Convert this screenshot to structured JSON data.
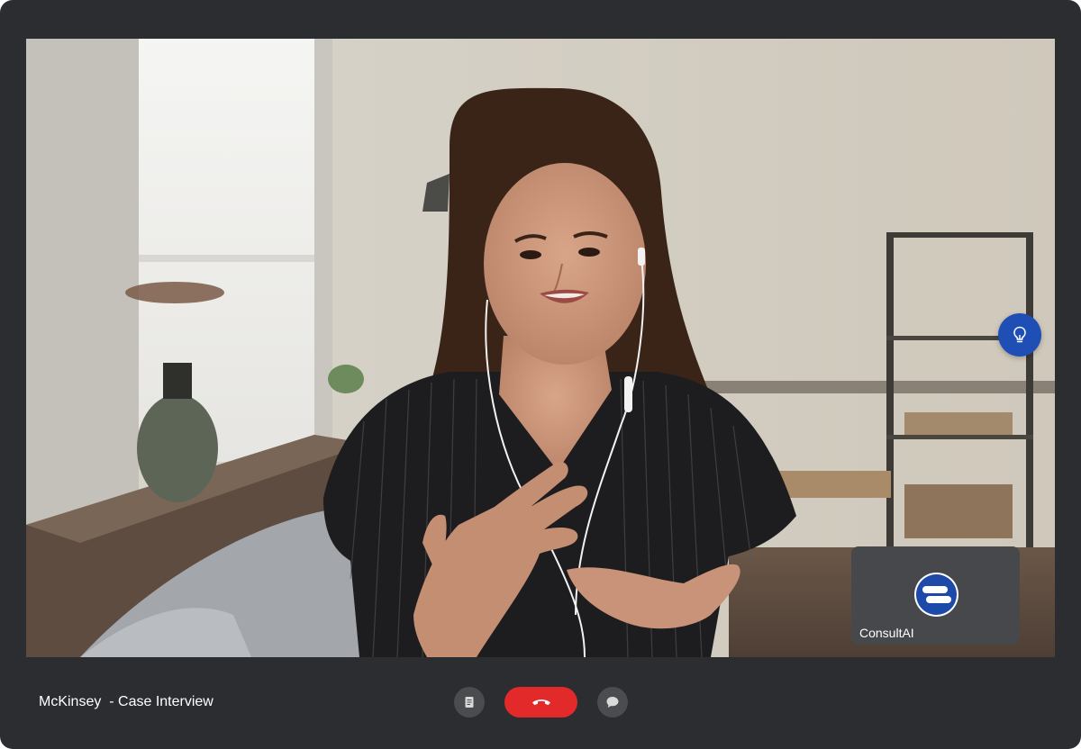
{
  "meeting": {
    "title": "McKinsey  - Case Interview"
  },
  "self_view": {
    "name": "ConsultAI"
  },
  "controls": {
    "notes_icon": "document-icon",
    "end_call_icon": "phone-hangup-icon",
    "chat_icon": "chat-bubble-icon",
    "tip_icon": "lightbulb-icon"
  },
  "colors": {
    "window_bg": "#2b2d31",
    "end_call": "#e32a2a",
    "tip_button": "#1f4fb4",
    "control_bg": "#4a4c50"
  }
}
